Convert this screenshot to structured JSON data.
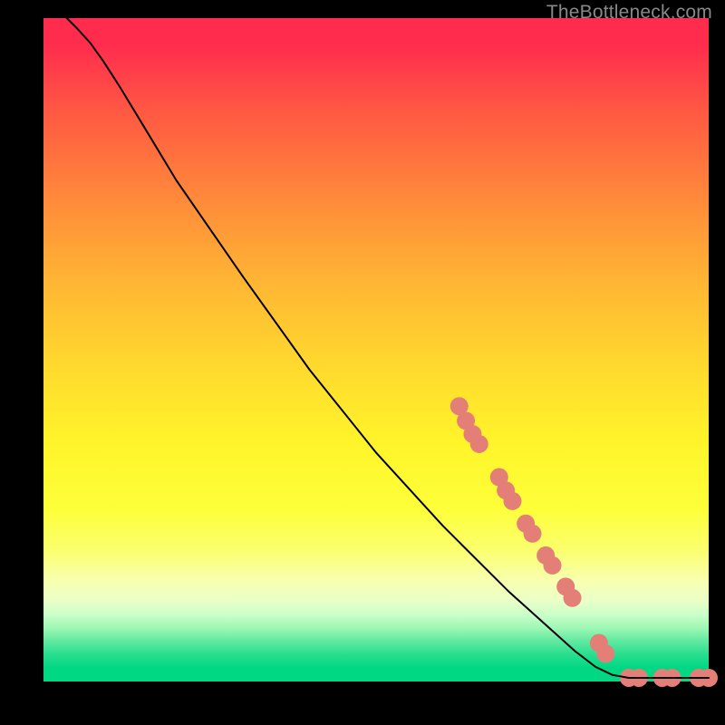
{
  "watermark": "TheBottleneck.com",
  "chart_data": {
    "type": "line",
    "title": "",
    "xlabel": "",
    "ylabel": "",
    "xlim": [
      0,
      100
    ],
    "ylim": [
      0,
      100
    ],
    "grid": false,
    "series": [
      {
        "name": "curve",
        "stroke": "#000000",
        "stroke_width": 2,
        "points": [
          {
            "x": 3.5,
            "y": 100.0
          },
          {
            "x": 5.0,
            "y": 98.5
          },
          {
            "x": 7.0,
            "y": 96.3
          },
          {
            "x": 9.0,
            "y": 93.5
          },
          {
            "x": 11.5,
            "y": 89.6
          },
          {
            "x": 15.0,
            "y": 83.8
          },
          {
            "x": 20.0,
            "y": 75.5
          },
          {
            "x": 30.0,
            "y": 61.0
          },
          {
            "x": 40.0,
            "y": 47.0
          },
          {
            "x": 50.0,
            "y": 34.5
          },
          {
            "x": 60.0,
            "y": 23.5
          },
          {
            "x": 70.0,
            "y": 13.5
          },
          {
            "x": 80.0,
            "y": 4.5
          },
          {
            "x": 83.0,
            "y": 2.2
          },
          {
            "x": 85.5,
            "y": 1.0
          },
          {
            "x": 88.0,
            "y": 0.55
          },
          {
            "x": 92.0,
            "y": 0.55
          },
          {
            "x": 96.0,
            "y": 0.55
          },
          {
            "x": 100.0,
            "y": 0.55
          }
        ]
      },
      {
        "name": "dots",
        "marker": "circle",
        "fill": "#e37f77",
        "radius": 10,
        "points": [
          {
            "x": 62.5,
            "y": 41.5
          },
          {
            "x": 63.5,
            "y": 39.3
          },
          {
            "x": 64.5,
            "y": 37.3
          },
          {
            "x": 65.5,
            "y": 35.8
          },
          {
            "x": 68.5,
            "y": 30.8
          },
          {
            "x": 69.5,
            "y": 28.8
          },
          {
            "x": 70.5,
            "y": 27.2
          },
          {
            "x": 72.5,
            "y": 23.8
          },
          {
            "x": 73.5,
            "y": 22.3
          },
          {
            "x": 75.5,
            "y": 19.0
          },
          {
            "x": 76.5,
            "y": 17.5
          },
          {
            "x": 78.5,
            "y": 14.3
          },
          {
            "x": 79.5,
            "y": 12.6
          },
          {
            "x": 83.5,
            "y": 5.8
          },
          {
            "x": 84.5,
            "y": 4.2
          },
          {
            "x": 88.0,
            "y": 0.55
          },
          {
            "x": 89.5,
            "y": 0.55
          },
          {
            "x": 93.0,
            "y": 0.55
          },
          {
            "x": 94.5,
            "y": 0.55
          },
          {
            "x": 98.5,
            "y": 0.55
          },
          {
            "x": 100.0,
            "y": 0.55
          }
        ]
      }
    ]
  }
}
